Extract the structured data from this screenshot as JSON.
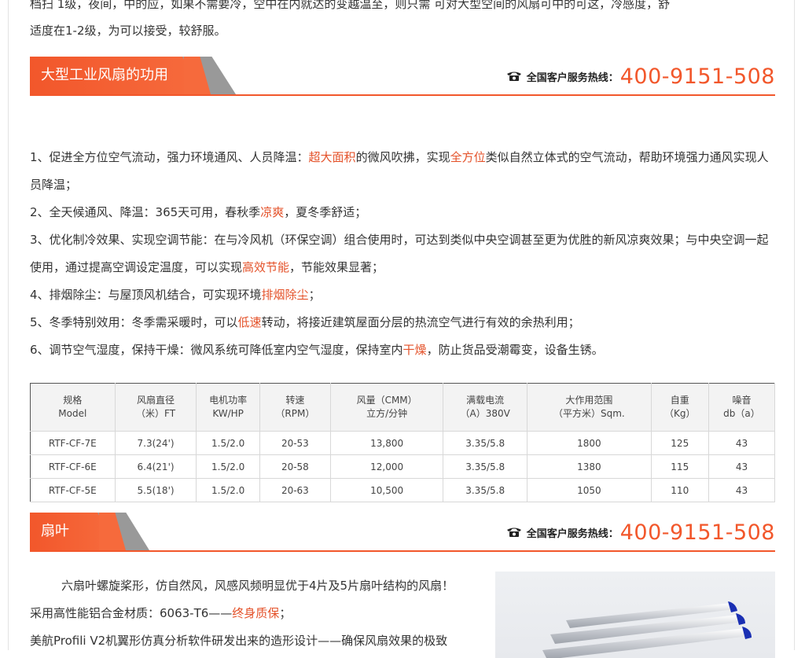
{
  "top_paragraph": {
    "line1": "档扫    1级，夜间，中的应，如果不需要冷，空中在内就达的变越温至，则只需        可对大型空间的风扇可中的可这，冷感度，舒",
    "line2": "适度在1-2级，为可以接受，较舒服。"
  },
  "section1": {
    "title": "大型工业风扇的功用",
    "hotline_label": "全国客户服务热线：",
    "hotline_number": "400-9151-508"
  },
  "benefits": [
    {
      "parts": [
        {
          "t": "1、促进全方位空气流动，强力环境通风、人员降温：",
          "h": false
        },
        {
          "t": "超大面积",
          "h": true
        },
        {
          "t": "的微风吹拂，实现",
          "h": false
        },
        {
          "t": "全方位",
          "h": true
        },
        {
          "t": "类似自然立体式的空气流动，帮助环境强力通风实现人员降温；",
          "h": false
        }
      ]
    },
    {
      "parts": [
        {
          "t": "2、全天候通风、降温：365天可用，春秋季",
          "h": false
        },
        {
          "t": "凉爽",
          "h": true
        },
        {
          "t": "，夏冬季舒适；",
          "h": false
        }
      ]
    },
    {
      "parts": [
        {
          "t": "3、优化制冷效果、实现空调节能：在与冷风机（环保空调）组合使用时，可达到类似中央空调甚至更为优胜的新风凉爽效果；与中央空调一起使用，通过提高空调设定温度，可以实现",
          "h": false
        },
        {
          "t": "高效节能",
          "h": true
        },
        {
          "t": "，节能效果显著；",
          "h": false
        }
      ]
    },
    {
      "parts": [
        {
          "t": "4、排烟除尘：与屋顶风机结合，可实现环境",
          "h": false
        },
        {
          "t": "排烟除尘",
          "h": true
        },
        {
          "t": "；",
          "h": false
        }
      ]
    },
    {
      "parts": [
        {
          "t": "5、冬季特别效用：冬季需采暖时，可以",
          "h": false
        },
        {
          "t": "低速",
          "h": true
        },
        {
          "t": "转动，将接近建筑屋面分层的热流空气进行有效的余热利用；",
          "h": false
        }
      ]
    },
    {
      "parts": [
        {
          "t": "6、调节空气湿度，保持干燥：微风系统可降低室内空气湿度，保持室内",
          "h": false
        },
        {
          "t": "干燥",
          "h": true
        },
        {
          "t": "，防止货品受潮霉变，设备生锈。",
          "h": false
        }
      ]
    }
  ],
  "spec_table": {
    "headers": [
      [
        "规格",
        "Model"
      ],
      [
        "风扇直径",
        "（米）FT"
      ],
      [
        "电机功率",
        "KW/HP"
      ],
      [
        "转速",
        "（RPM）"
      ],
      [
        "风量（CMM）",
        "立方/分钟"
      ],
      [
        "满载电流",
        "（A）380V"
      ],
      [
        "大作用范围",
        "（平方米）Sqm."
      ],
      [
        "自重",
        "（Kg）"
      ],
      [
        "噪音",
        "db（a）"
      ]
    ],
    "rows": [
      [
        "RTF-CF-7E",
        "7.3(24')",
        "1.5/2.0",
        "20-53",
        "13,800",
        "3.35/5.8",
        "1800",
        "125",
        "43"
      ],
      [
        "RTF-CF-6E",
        "6.4(21')",
        "1.5/2.0",
        "20-58",
        "12,000",
        "3.35/5.8",
        "1380",
        "115",
        "43"
      ],
      [
        "RTF-CF-5E",
        "5.5(18')",
        "1.5/2.0",
        "20-63",
        "10,500",
        "3.35/5.8",
        "1050",
        "110",
        "43"
      ]
    ]
  },
  "section2": {
    "title": "扇叶",
    "hotline_label": "全国客户服务热线：",
    "hotline_number": "400-9151-508"
  },
  "blade": {
    "line1": "六扇叶螺旋桨形，仿自然风，风感风频明显优于4片及5片扇叶结构的风扇！",
    "line2_a": "采用高性能铝合金材质：6063-T6——",
    "line2_hl": "终身质保",
    "line2_b": "；",
    "line3": "美航Profili V2机翼形仿真分析软件研发出来的造形设计——确保风扇效果的极致"
  },
  "colors": {
    "accent": "#f2572b",
    "highlight": "#e4522a"
  }
}
